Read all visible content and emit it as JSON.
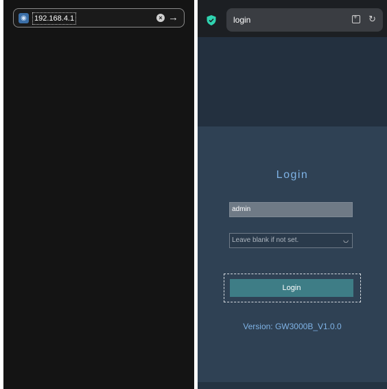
{
  "left_browser": {
    "url": "192.168.4.1",
    "icons": {
      "site": "globe-icon",
      "clear": "clear-icon",
      "go": "arrow-right-icon"
    }
  },
  "right_browser": {
    "tab_title": "login",
    "icons": {
      "security": "shield-icon",
      "bookmark": "bookmark-add-icon",
      "reload": "reload-icon"
    }
  },
  "login_page": {
    "title": "Login",
    "username_value": "admin",
    "password_placeholder": "Leave blank if not set.",
    "password_toggle_icon": "eye-icon",
    "login_button": "Login",
    "version": "Version: GW3000B_V1.0.0"
  },
  "colors": {
    "accent": "#7fb3e6",
    "button": "#3e7d86",
    "page_bg": "#2f4154",
    "header_bg": "#23303f"
  }
}
